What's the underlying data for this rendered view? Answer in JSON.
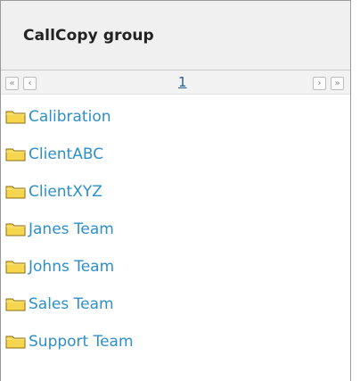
{
  "panel": {
    "title": "CallCopy group"
  },
  "pager": {
    "first_label": "«",
    "prev_label": "‹",
    "next_label": "›",
    "last_label": "»",
    "current_page": "1"
  },
  "folders": [
    {
      "label": "Calibration",
      "icon": "folder-icon"
    },
    {
      "label": "ClientABC",
      "icon": "folder-icon"
    },
    {
      "label": "ClientXYZ",
      "icon": "folder-icon"
    },
    {
      "label": "Janes Team",
      "icon": "folder-icon"
    },
    {
      "label": "Johns Team",
      "icon": "folder-icon"
    },
    {
      "label": "Sales Team",
      "icon": "folder-icon"
    },
    {
      "label": "Support Team",
      "icon": "folder-icon"
    }
  ],
  "colors": {
    "link": "#2e8fc8",
    "folder_fill": "#f5d64e",
    "folder_stroke": "#8c6d12"
  }
}
